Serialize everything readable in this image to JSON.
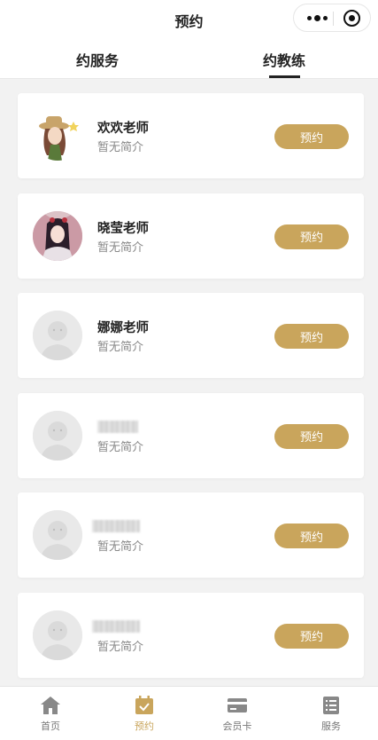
{
  "header": {
    "title": "预约"
  },
  "tabs": [
    {
      "label": "约服务",
      "active": false
    },
    {
      "label": "约教练",
      "active": true
    }
  ],
  "coaches": [
    {
      "name": "欢欢老师",
      "intro": "暂无简介",
      "button": "预约",
      "avatar": "cartoon-girl"
    },
    {
      "name": "晓莹老师",
      "intro": "暂无简介",
      "button": "预约",
      "avatar": "anime-portrait"
    },
    {
      "name": "娜娜老师",
      "intro": "暂无简介",
      "button": "预约",
      "avatar": "default"
    },
    {
      "name": "",
      "intro": "暂无简介",
      "button": "预约",
      "avatar": "default"
    },
    {
      "name": "",
      "intro": "暂无简介",
      "button": "预约",
      "avatar": "default"
    },
    {
      "name": "",
      "intro": "暂无简介",
      "button": "预约",
      "avatar": "default"
    }
  ],
  "tabbar": [
    {
      "label": "首页",
      "icon": "home-icon",
      "active": false
    },
    {
      "label": "预约",
      "icon": "calendar-check-icon",
      "active": true
    },
    {
      "label": "会员卡",
      "icon": "card-icon",
      "active": false
    },
    {
      "label": "服务",
      "icon": "list-icon",
      "active": false
    }
  ],
  "colors": {
    "accent": "#c9a55c",
    "tab_inactive": "#999999"
  }
}
